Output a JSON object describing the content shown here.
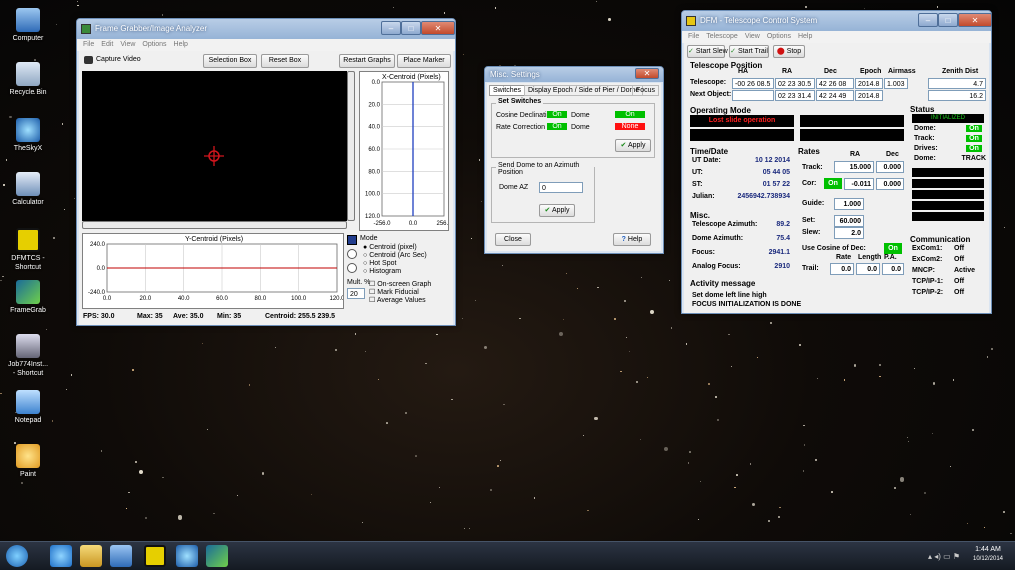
{
  "colors": {
    "title_bar": "#96b3d6",
    "status_green": "#00c000",
    "status_red": "#ff1010",
    "graph_blue": "#1f3fbf",
    "graph_red": "#c00000"
  },
  "desktop": {
    "icons": [
      {
        "label": "Computer",
        "icon": "computer-icon"
      },
      {
        "label": "Recycle Bin",
        "icon": "recycle-bin-icon"
      },
      {
        "label": "TheSkyX",
        "icon": "theskyx-icon"
      },
      {
        "label": "Calculator",
        "icon": "calculator-icon"
      },
      {
        "label": "DFMTCS - Shortcut",
        "icon": "dfmtcs-icon"
      },
      {
        "label": "FrameGrab",
        "icon": "framegrab-icon"
      },
      {
        "label": "Job774Inst... - Shortcut",
        "icon": "installer-icon"
      },
      {
        "label": "Notepad",
        "icon": "notepad-icon"
      },
      {
        "label": "Paint",
        "icon": "paint-icon"
      }
    ]
  },
  "frame": {
    "title": "Frame Grabber/Image Analyzer",
    "menu": [
      "File",
      "Edit",
      "View",
      "Options",
      "Help"
    ],
    "toolbar": {
      "capture": "Capture Video",
      "selection": "Selection Box",
      "reset": "Reset Box",
      "restart": "Restart Graphs",
      "place": "Place Marker"
    },
    "xgraph": {
      "title": "X-Centroid (Pixels)",
      "yticks": [
        "0.0",
        "20.0",
        "40.0",
        "60.0",
        "80.0",
        "100.0",
        "120.0"
      ],
      "xticks": [
        "-256.0",
        "0.0",
        "256.0"
      ]
    },
    "ygraph": {
      "title": "Y-Centroid (Pixels)",
      "yticks": [
        "240.0",
        "0.0",
        "-240.0"
      ],
      "xticks": [
        "0.0",
        "20.0",
        "40.0",
        "60.0",
        "80.0",
        "100.0",
        "120.0"
      ]
    },
    "mode": {
      "title": "Mode",
      "options": [
        "Centroid (pixel)",
        "Centroid (Arc Sec)",
        "Hot Spot",
        "Histogram"
      ]
    },
    "mult_label": "Mult. %",
    "mult_value": "20",
    "checks": [
      "On-screen Graph",
      "Mark Fiducial",
      "Average Values"
    ],
    "status": {
      "fps": "FPS:  30.0",
      "max": "Max:   35",
      "ave": "Ave:  35.0",
      "min": "Min:    35",
      "centroid": "Centroid:  255.5  239.5"
    }
  },
  "misc": {
    "title": "Misc. Settings",
    "tabs": [
      "Switches",
      "Display Epoch / Side of Pier / Dome",
      "Focus"
    ],
    "set_switches": "Set Switches",
    "rows": [
      {
        "label": "Cosine Declination",
        "state": "On",
        "label2": "Dome",
        "state2": "On"
      },
      {
        "label": "Rate Correction",
        "state": "On",
        "label2": "Dome",
        "state2": "None"
      }
    ],
    "apply": "Apply",
    "dome_group": "Send Dome to an Azimuth Position",
    "dome_az_label": "Dome AZ",
    "dome_az_value": "0",
    "close": "Close",
    "help": "Help"
  },
  "dfm": {
    "title": "DFM - Telescope Control System",
    "menu": [
      "File",
      "Telescope",
      "View",
      "Options",
      "Help"
    ],
    "toolbar": {
      "slew": "Start Slew",
      "trail": "Start Trail",
      "stop": "Stop"
    },
    "pos_title": "Telescope Position",
    "pos_headers": [
      "HA",
      "RA",
      "Dec",
      "Epoch",
      "Airmass",
      "Zenith Dist"
    ],
    "telescope": {
      "label": "Telescope:",
      "ha": "-00 26 08.5",
      "ra": "02 23 30.5",
      "dec": "42 26 08",
      "epoch": "2014.8",
      "airmass": "1.003",
      "zd": "4.7"
    },
    "next": {
      "label": "Next Object:",
      "ra": "02 23 31.4",
      "dec": "42 24 49",
      "epoch": "2014.8",
      "zd": "16.2"
    },
    "op_title": "Operating Mode",
    "op_mode": "Lost slide operation",
    "time_title": "Time/Date",
    "time": [
      {
        "k": "UT Date:",
        "v": "10 12 2014"
      },
      {
        "k": "UT:",
        "v": "05 44 05"
      },
      {
        "k": "ST:",
        "v": "01 57 22"
      },
      {
        "k": "Julian:",
        "v": "2456942.738934"
      }
    ],
    "misc_title": "Misc.",
    "misc": [
      {
        "k": "Telescope Azimuth:",
        "v": "89.2"
      },
      {
        "k": "Dome Azimuth:",
        "v": "75.4"
      },
      {
        "k": "Focus:",
        "v": "2941.1"
      },
      {
        "k": "Analog Focus:",
        "v": "2910"
      }
    ],
    "rates": {
      "title": "Rates",
      "ra": "RA",
      "dec": "Dec",
      "track_label": "Track:",
      "track_ra": "15.000",
      "track_dec": "0.000",
      "cor_label": "Cor:",
      "cor_on": "On",
      "cor_ra": "-0.011",
      "cor_dec": "0.000",
      "guide_label": "Guide:",
      "guide": "1.000",
      "set_label": "Set:",
      "set": "60.000",
      "slew_label": "Slew:",
      "slew": "2.0",
      "cosdec_label": "Use Cosine of Dec:",
      "cosdec": "On",
      "trail_h": [
        "Rate",
        "Length",
        "P.A."
      ],
      "trail_label": "Trail:",
      "trail": [
        "0.0",
        "0.0",
        "0.0"
      ]
    },
    "status": {
      "title": "Status",
      "state": "INITIALIZED",
      "rows": [
        {
          "k": "Dome:",
          "v": "On"
        },
        {
          "k": "Track:",
          "v": "On"
        },
        {
          "k": "Drives:",
          "v": "On"
        },
        {
          "k": "Dome:",
          "v": "TRACK"
        }
      ]
    },
    "comm": {
      "title": "Communication",
      "rows": [
        {
          "k": "ExCom1:",
          "v": "Off"
        },
        {
          "k": "ExCom2:",
          "v": "Off"
        },
        {
          "k": "MNCP:",
          "v": "Active"
        },
        {
          "k": "TCP/IP-1:",
          "v": "Off"
        },
        {
          "k": "TCP/IP-2:",
          "v": "Off"
        }
      ]
    },
    "activity_title": "Activity message",
    "activity": [
      "Set dome left line high",
      "FOCUS INITIALIZATION IS DONE"
    ]
  },
  "taskbar": {
    "time": "1:44 AM",
    "date": "10/12/2014"
  }
}
